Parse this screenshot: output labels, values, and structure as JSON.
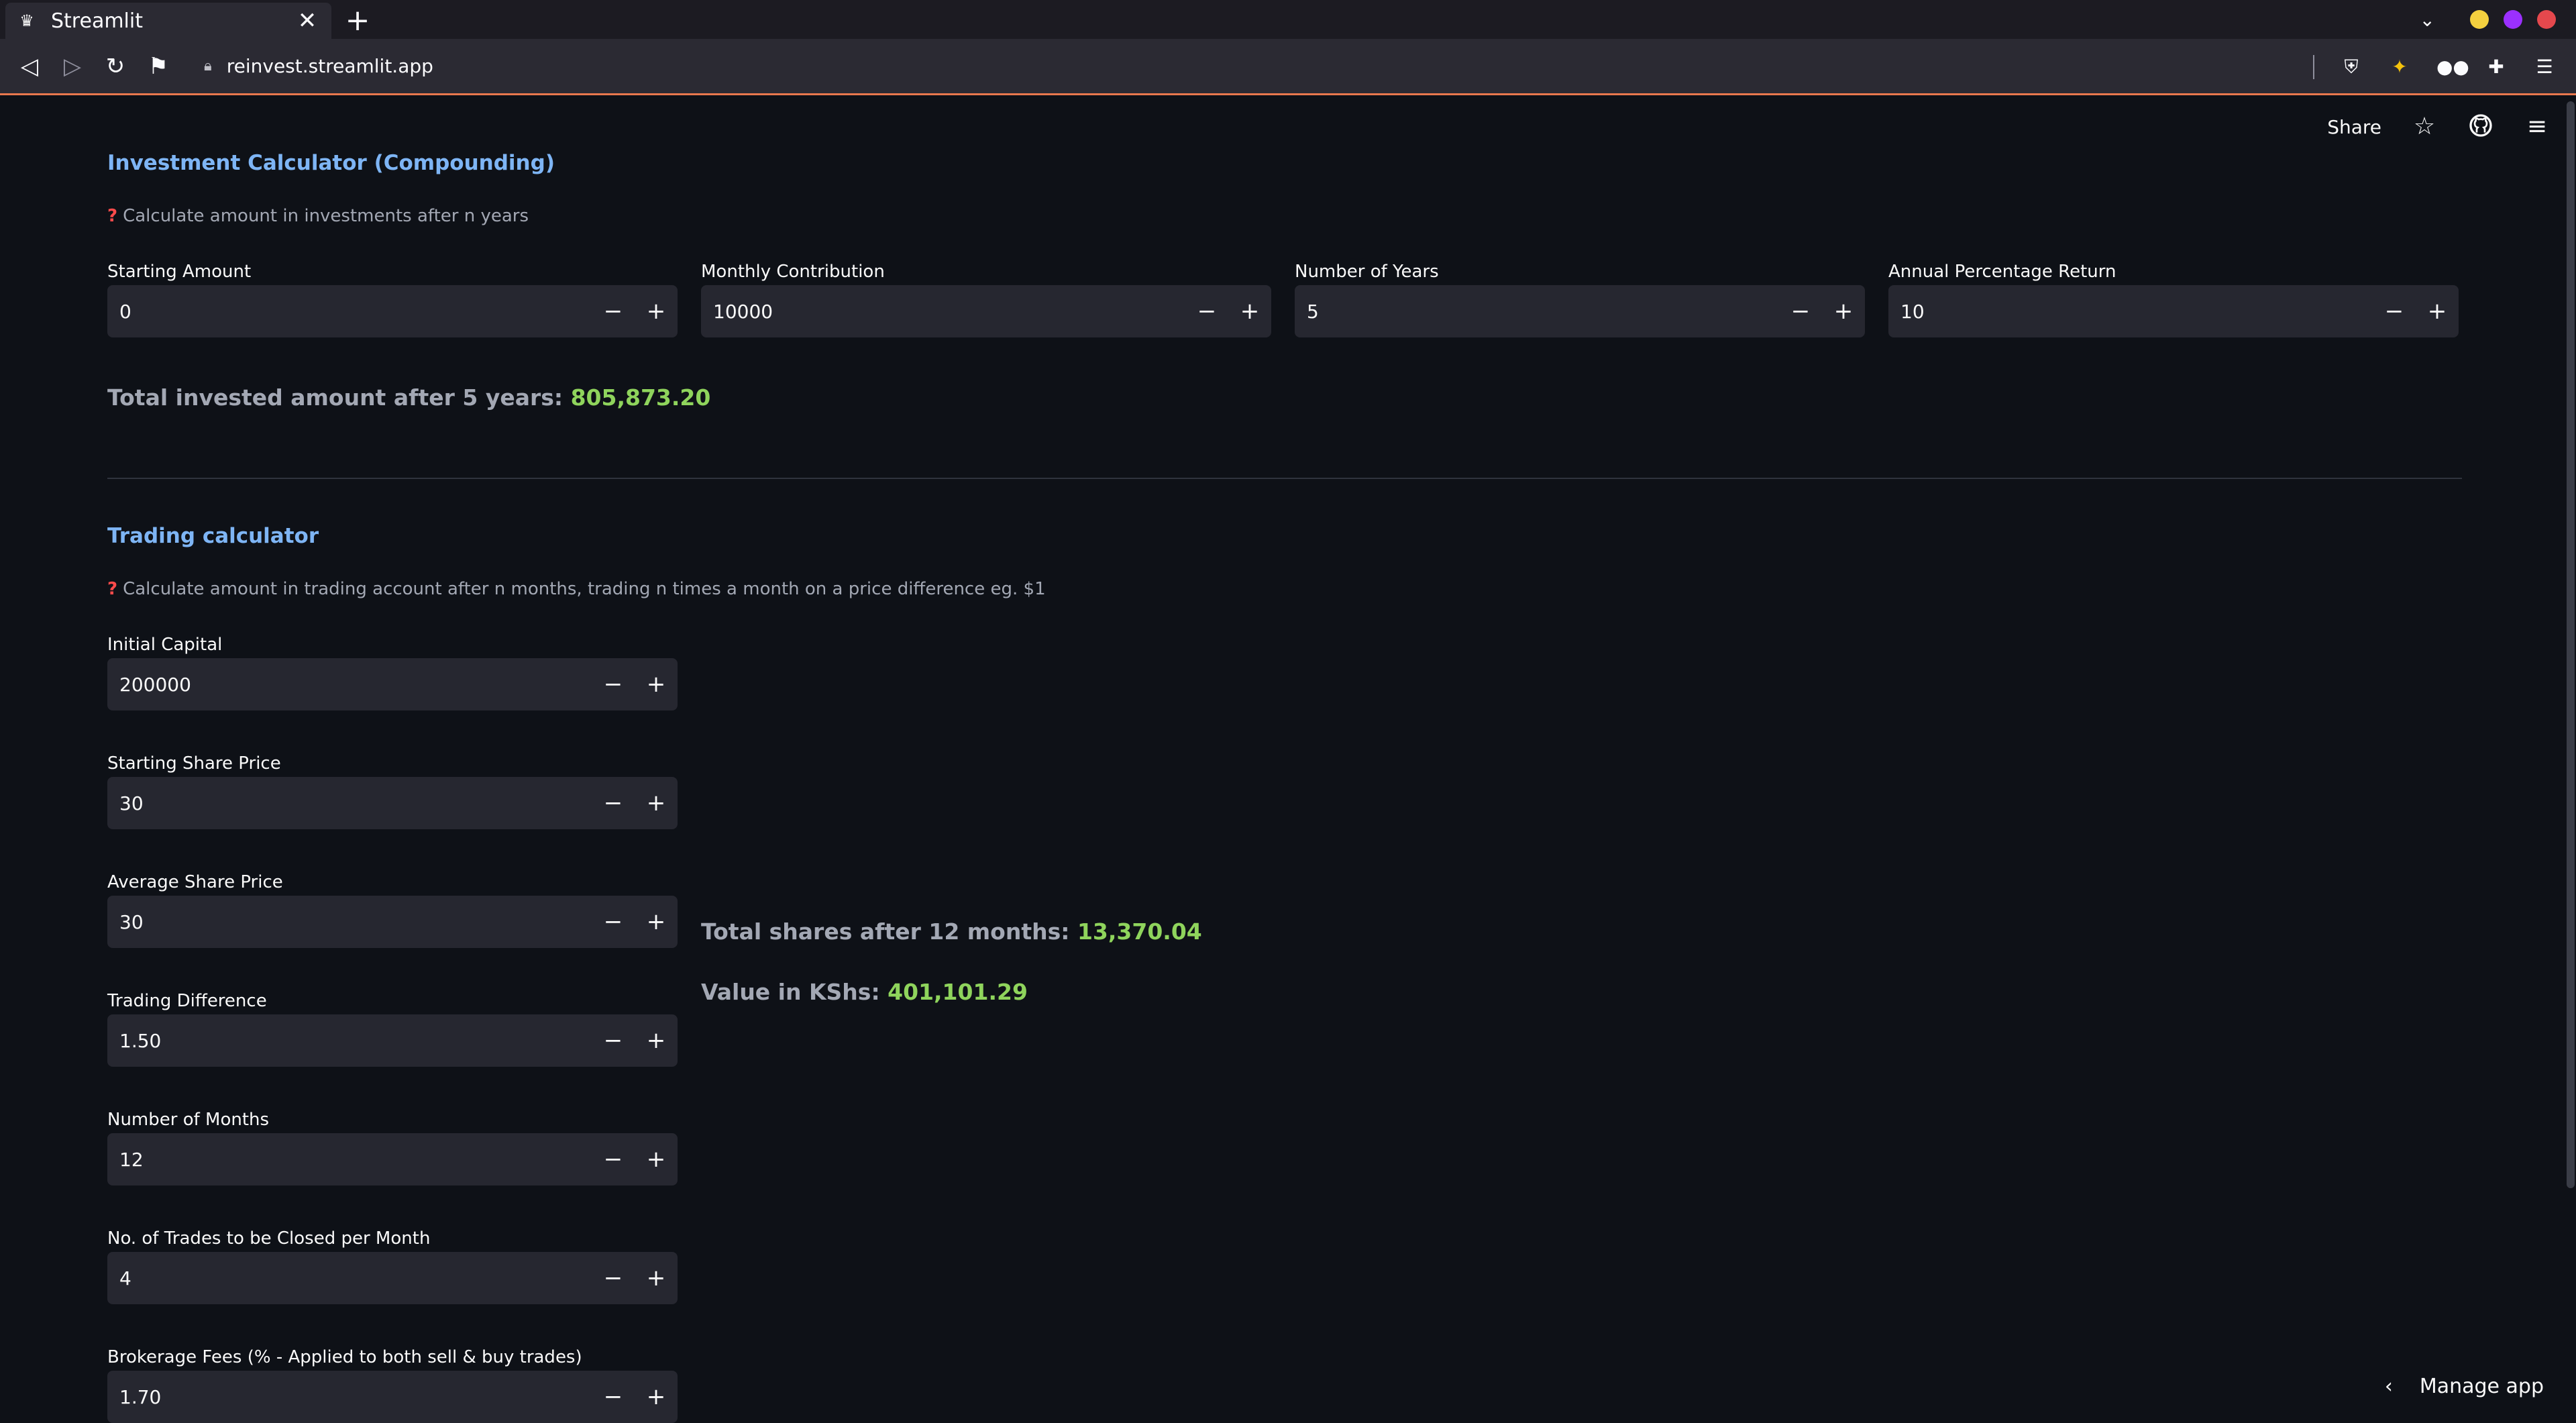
{
  "browser": {
    "tab_title": "Streamlit",
    "tab_close": "✕",
    "new_tab": "+",
    "url": "reinvest.streamlit.app",
    "window_dots": [
      "#f4d03f",
      "#9b30ff",
      "#e5484d"
    ]
  },
  "app": {
    "toolbar": {
      "share_label": "Share"
    },
    "manage_app": "Manage app"
  },
  "investment": {
    "title": "Investment Calculator (Compounding)",
    "caption": "Calculate amount in investments after n years",
    "fields": [
      {
        "label": "Starting Amount",
        "value": "0"
      },
      {
        "label": "Monthly Contribution",
        "value": "10000"
      },
      {
        "label": "Number of Years",
        "value": "5"
      },
      {
        "label": "Annual Percentage Return",
        "value": "10"
      }
    ],
    "result_label": "Total invested amount after 5 years: ",
    "result_value": "805,873.20"
  },
  "trading": {
    "title": "Trading calculator",
    "caption": "Calculate amount in trading account after n months, trading n times a month on a price difference eg. $1",
    "fields": [
      {
        "label": "Initial Capital",
        "value": "200000"
      },
      {
        "label": "Starting Share Price",
        "value": "30"
      },
      {
        "label": "Average Share Price",
        "value": "30"
      },
      {
        "label": "Trading Difference",
        "value": "1.50"
      },
      {
        "label": "Number of Months",
        "value": "12"
      },
      {
        "label": "No. of Trades to be Closed per Month",
        "value": "4"
      },
      {
        "label": "Brokerage Fees (% - Applied to both sell & buy trades)",
        "value": "1.70"
      }
    ],
    "shares_label": "Total shares after 12 months: ",
    "shares_value": "13,370.04",
    "value_label": "Value in KShs: ",
    "value_value": "401,101.29"
  },
  "stepper": {
    "minus": "−",
    "plus": "+"
  },
  "colors": {
    "background": "#0e1117",
    "input_bg": "#262730",
    "heading": "#7eb5f5",
    "accent_green": "#8fd45c",
    "accent_red": "#ff4b4b"
  }
}
